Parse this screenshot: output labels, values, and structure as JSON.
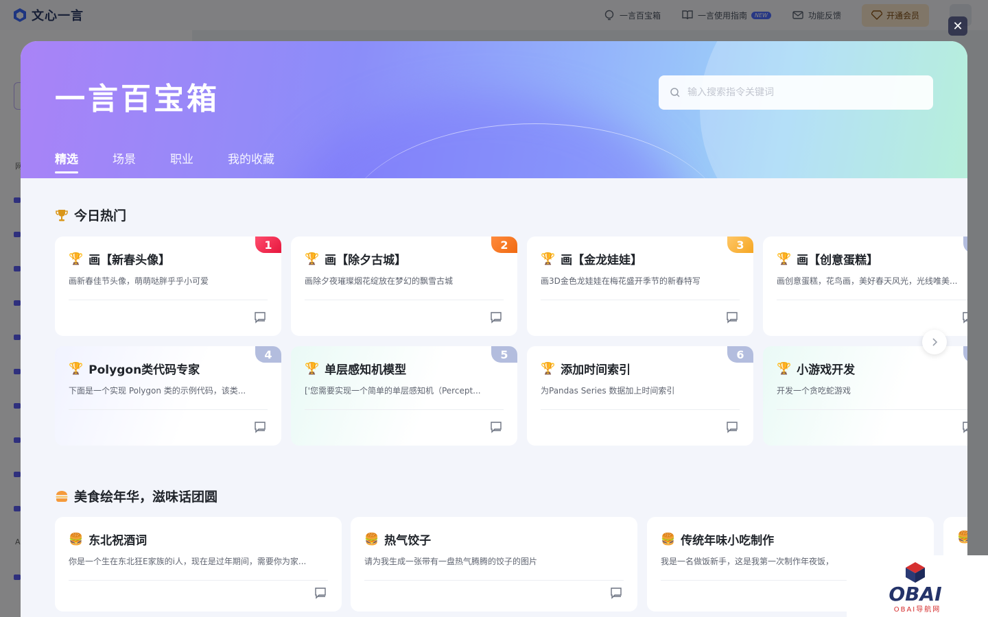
{
  "app": {
    "brand": "文心一言"
  },
  "header": {
    "nav": [
      {
        "label": "一言百宝箱",
        "icon": "bulb-icon"
      },
      {
        "label": "一言使用指南",
        "icon": "book-icon",
        "badge": "NEW"
      },
      {
        "label": "功能反馈",
        "icon": "mail-icon"
      }
    ],
    "vip_label": "开通会员"
  },
  "sidebar": {
    "chars": [
      "网",
      "A"
    ]
  },
  "modal": {
    "title": "一言百宝箱",
    "search_placeholder": "输入搜索指令关键词",
    "tabs": [
      "精选",
      "场景",
      "职业",
      "我的收藏"
    ],
    "active_tab": 0
  },
  "hot": {
    "title": "今日热门",
    "cards": [
      {
        "title": "画【新春头像】",
        "desc": "画新春佳节头像，萌萌哒胖乎乎小可爱",
        "rank": "1"
      },
      {
        "title": "画【除夕古城】",
        "desc": "画除夕夜璀璨烟花绽放在梦幻的飘雪古城",
        "rank": "2"
      },
      {
        "title": "画【金龙娃娃】",
        "desc": "画3D金色龙娃娃在梅花盛开季节的新春特写",
        "rank": "3"
      },
      {
        "title": "画【创意蛋糕】",
        "desc": "画创意蛋糕，花鸟画，美好春天风光，光线唯美...",
        "rank": ""
      },
      {
        "title": "Polygon类代码专家",
        "desc": "下面是一个实现 Polygon 类的示例代码，该类...",
        "rank": "4"
      },
      {
        "title": "单层感知机模型",
        "desc": "['您需要实现一个简单的单层感知机（Percept...",
        "rank": "5"
      },
      {
        "title": "添加时间索引",
        "desc": "为Pandas Series 数据加上时间索引",
        "rank": "6"
      },
      {
        "title": "小游戏开发",
        "desc": "开发一个贪吃蛇游戏",
        "rank": ""
      }
    ]
  },
  "food": {
    "title": "美食绘年华，滋味话团圆",
    "cards": [
      {
        "title": "东北祝酒词",
        "desc": "你是一个生在东北狂E家族的i人，现在是过年期间，需要你为家..."
      },
      {
        "title": "热气饺子",
        "desc": "请为我生成一张带有一盘热气腾腾的饺子的图片"
      },
      {
        "title": "传统年味小吃制作",
        "desc": "我是一名做饭新手，这是我第一次制作年夜饭，"
      }
    ]
  },
  "watermark": {
    "name": "OBAI",
    "sub": "OBAI导航网"
  },
  "colors": {
    "accent": "#4d6bfe",
    "rank1": "#e6163d",
    "rank2": "#f06a12",
    "rank3": "#f5a623",
    "trophy": "#c98a12"
  }
}
